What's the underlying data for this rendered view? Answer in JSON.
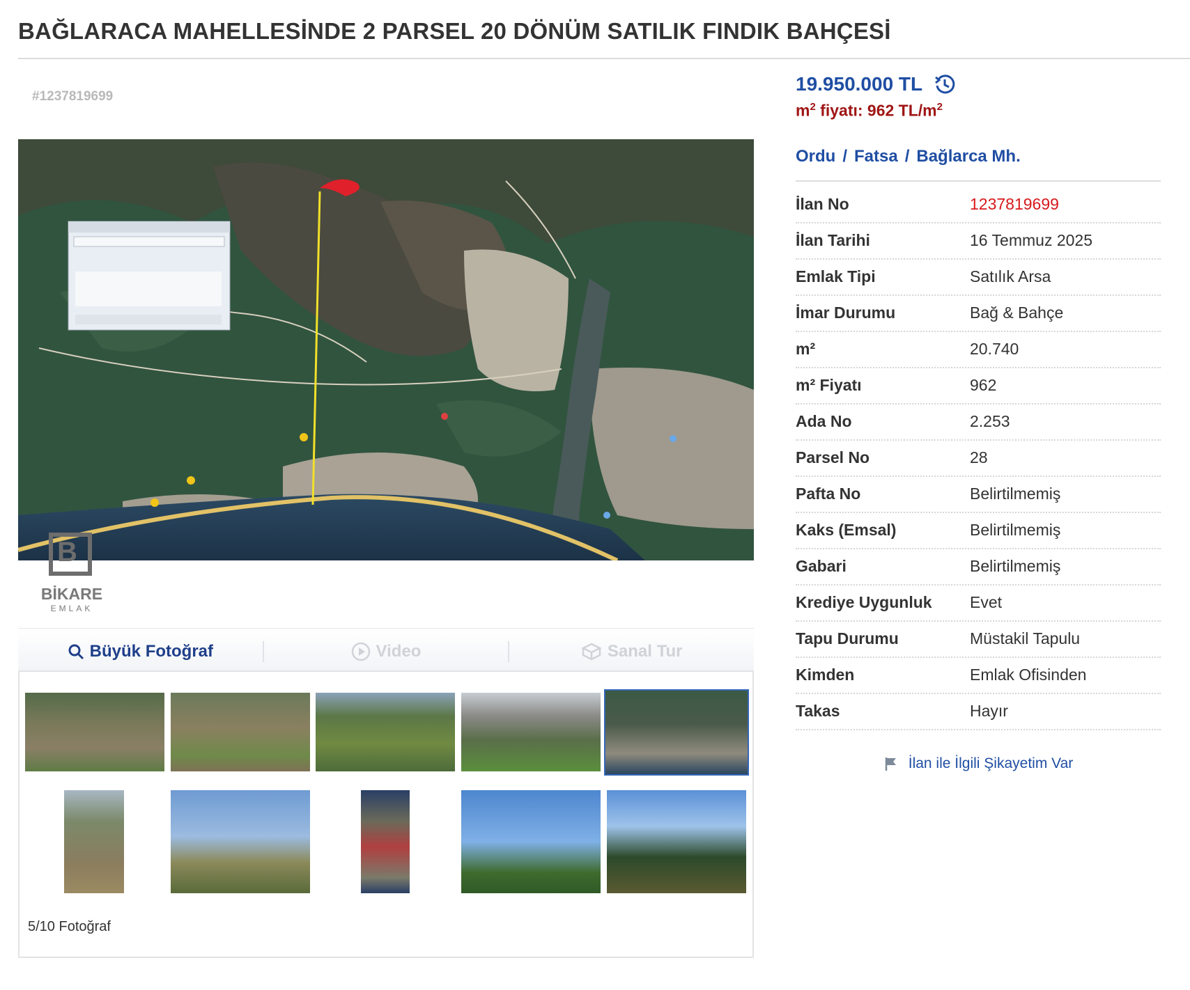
{
  "header": {
    "title": "BAĞLARACA MAHELLESİNDE 2 PARSEL 20 DÖNÜM SATILIK FINDIK BAHÇESİ"
  },
  "gallery": {
    "watermark_id": "#1237819699",
    "brand": {
      "name": "BİKARE",
      "sub": "EMLAK"
    },
    "media_tabs": {
      "photo": "Büyük Fotoğraf",
      "video": "Video",
      "tour": "Sanal Tur"
    },
    "photo_count": "5/10 Fotoğraf",
    "selected_index": 5
  },
  "listing": {
    "price": "19.950.000 TL",
    "m2_price_prefix": "m",
    "m2_price_sup": "2",
    "m2_price_text": " fiyatı: 962 TL/m",
    "m2_price_sup2": "2",
    "location": {
      "il": "Ordu",
      "ilce": "Fatsa",
      "mahalle": "Bağlarca Mh.",
      "sep": "/"
    },
    "details": [
      {
        "label": "İlan No",
        "value": "1237819699",
        "highlight": true
      },
      {
        "label": "İlan Tarihi",
        "value": "16 Temmuz 2025"
      },
      {
        "label": "Emlak Tipi",
        "value": "Satılık Arsa"
      },
      {
        "label": "İmar Durumu",
        "value": "Bağ & Bahçe"
      },
      {
        "label": "m²",
        "value": "20.740"
      },
      {
        "label": "m² Fiyatı",
        "value": "962"
      },
      {
        "label": "Ada No",
        "value": "2.253"
      },
      {
        "label": "Parsel No",
        "value": "28"
      },
      {
        "label": "Pafta No",
        "value": "Belirtilmemiş"
      },
      {
        "label": "Kaks (Emsal)",
        "value": "Belirtilmemiş"
      },
      {
        "label": "Gabari",
        "value": "Belirtilmemiş"
      },
      {
        "label": "Krediye Uygunluk",
        "value": "Evet"
      },
      {
        "label": "Tapu Durumu",
        "value": "Müstakil Tapulu"
      },
      {
        "label": "Kimden",
        "value": "Emlak Ofisinden"
      },
      {
        "label": "Takas",
        "value": "Hayır"
      }
    ],
    "complaint": "İlan ile İlgili Şikayetim Var"
  },
  "colors": {
    "accent": "#1f4ea3",
    "price_red": "#a01515",
    "id_red": "#d8191c"
  }
}
